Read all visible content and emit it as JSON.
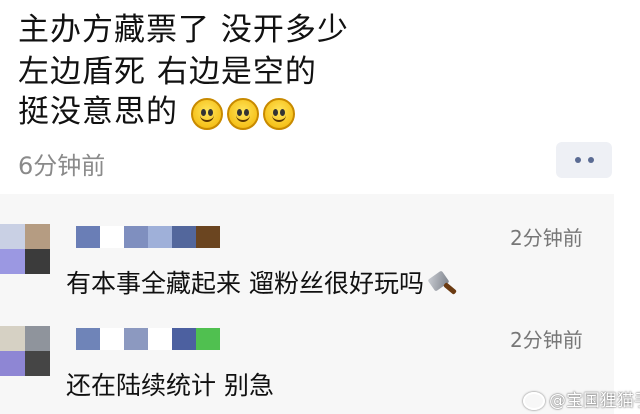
{
  "post": {
    "lines": [
      "主办方藏票了 没开多少",
      "左边盾死 右边是空的",
      "挺没意思的"
    ],
    "emoji_count": 3,
    "emoji_icon": "smiley-icon",
    "time": "6分钟前",
    "more_icon": "more-dots-icon"
  },
  "comments": [
    {
      "time": "2分钟前",
      "text": "有本事全藏起来 遛粉丝很好玩吗",
      "trailing_icon": "cleaver-icon",
      "avatar_colors": [
        "#c9d0e4",
        "#b59c82",
        "#9b98e2",
        "#3b3b3b"
      ],
      "name_colors": [
        "#6a7eb6",
        "#ffffff",
        "#7f8fbf",
        "#9fb0d9",
        "#53679c",
        "#6b4520"
      ]
    },
    {
      "time": "2分钟前",
      "text": "还在陆续统计 别急",
      "avatar_colors": [
        "#d6d1c4",
        "#8f949c",
        "#8e86d4",
        "#454545"
      ],
      "name_colors": [
        "#6f84b8",
        "#ffffff",
        "#8c99c0",
        "#ffffff",
        "#4c60a0",
        "#50c050"
      ]
    }
  ],
  "watermark": "@宝国狸猫手"
}
